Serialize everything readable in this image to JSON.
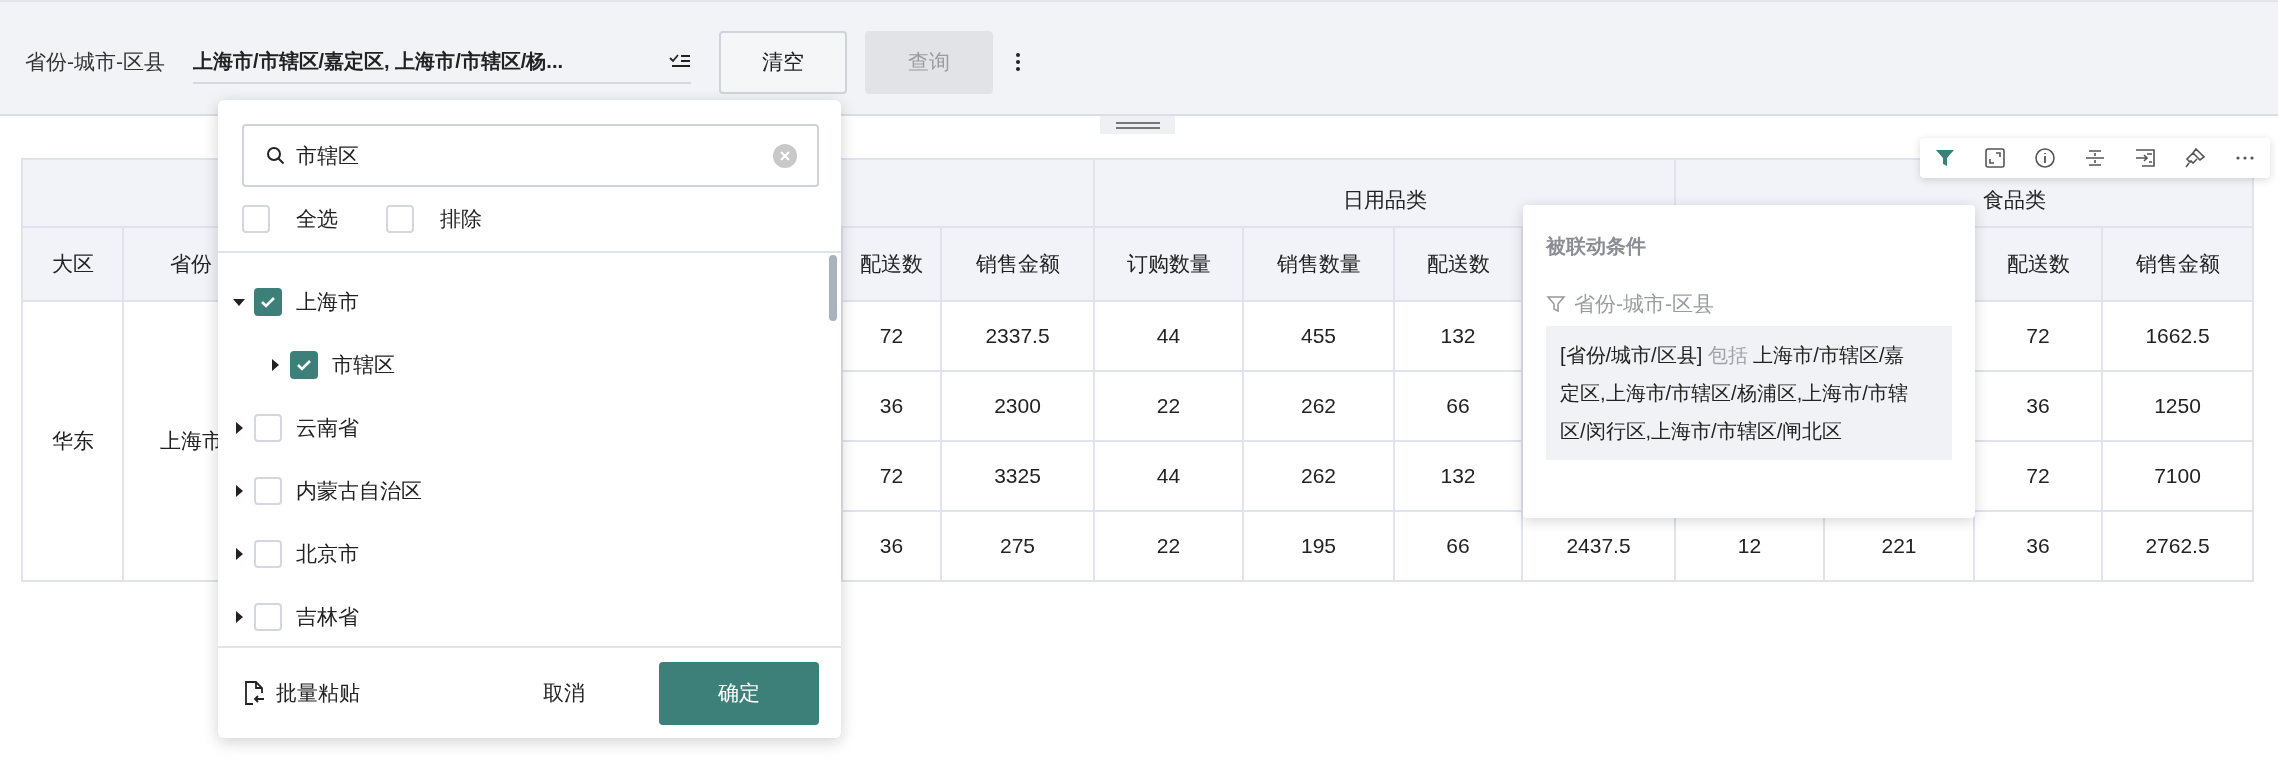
{
  "filter_bar": {
    "label": "省份-城市-区县",
    "value": "上海市/市辖区/嘉定区, 上海市/市辖区/杨...",
    "buttons": [
      {
        "label": "清空",
        "disabled": false
      },
      {
        "label": "查询",
        "disabled": true
      }
    ]
  },
  "dropdown": {
    "search": {
      "value": "市辖区"
    },
    "options": [
      {
        "label": "全选",
        "checked": false
      },
      {
        "label": "排除",
        "checked": false
      }
    ],
    "tree": [
      {
        "label": "上海市",
        "checked": true,
        "expanded": true,
        "children": [
          {
            "label": "市辖区",
            "checked": true,
            "expanded": false
          }
        ]
      },
      {
        "label": "云南省",
        "checked": false,
        "expanded": false
      },
      {
        "label": "内蒙古自治区",
        "checked": false,
        "expanded": false
      },
      {
        "label": "北京市",
        "checked": false,
        "expanded": false
      },
      {
        "label": "吉林省",
        "checked": false,
        "expanded": false
      }
    ],
    "footer": {
      "paste_label": "批量粘贴",
      "cancel_label": "取消",
      "confirm_label": "确定"
    }
  },
  "table": {
    "group_headers": [
      "日用品类",
      "食品类"
    ],
    "columns": [
      "大区",
      "省份",
      null,
      null,
      null,
      null,
      "配送数",
      "销售金额",
      "订购数量",
      "销售数量",
      "配送数",
      null,
      null,
      null,
      "配送数",
      "销售金额"
    ],
    "rows": [
      [
        {
          "text": "华东",
          "rowspan": 4
        },
        {
          "text": "上海市",
          "rowspan": 4
        },
        null,
        null,
        null,
        null,
        "72",
        "2337.5",
        "44",
        "455",
        "132",
        null,
        null,
        null,
        "72",
        "1662.5"
      ],
      [
        null,
        null,
        null,
        null,
        "36",
        "2300",
        "22",
        "262",
        "66",
        null,
        null,
        null,
        "36",
        "1250"
      ],
      [
        null,
        null,
        null,
        null,
        "72",
        "3325",
        "44",
        "262",
        "132",
        null,
        null,
        null,
        "72",
        "7100"
      ],
      [
        null,
        null,
        null,
        null,
        "36",
        "275",
        "22",
        "195",
        "66",
        "2437.5",
        "12",
        "221",
        "36",
        "2762.5"
      ]
    ]
  },
  "tooltip": {
    "title": "被联动条件",
    "field_label": "省份-城市-区县",
    "condition": {
      "field": "[省份/城市/区县]",
      "operator": "包括",
      "values": "上海市/市辖区/嘉定区,上海市/市辖区/杨浦区,上海市/市辖区/闵行区,上海市/市辖区/闸北区"
    }
  }
}
